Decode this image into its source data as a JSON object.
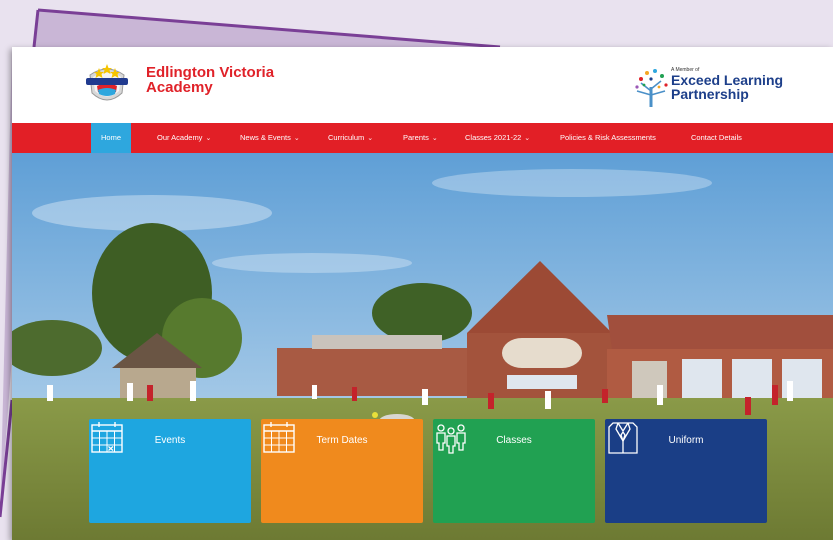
{
  "header": {
    "school_name_line1": "Edlington Victoria",
    "school_name_line2": "Academy",
    "crest_text": "Edlington Victoria Academy",
    "partner_small": "A Member of",
    "partner_line1": "Exceed Learning",
    "partner_line2": "Partnership"
  },
  "nav": {
    "items": [
      {
        "label": "Home",
        "dropdown": false,
        "active": true
      },
      {
        "label": "Our Academy",
        "dropdown": true
      },
      {
        "label": "News & Events",
        "dropdown": true
      },
      {
        "label": "Curriculum",
        "dropdown": true
      },
      {
        "label": "Parents",
        "dropdown": true
      },
      {
        "label": "Classes 2021-22",
        "dropdown": true
      },
      {
        "label": "Policies & Risk Assessments",
        "dropdown": false
      },
      {
        "label": "Contact Details",
        "dropdown": false
      }
    ],
    "caret": "⌄"
  },
  "tiles": [
    {
      "label": "Events",
      "color": "#1ea6e0",
      "icon": "calendar-icon"
    },
    {
      "label": "Term Dates",
      "color": "#f08a1d",
      "icon": "calendar-grid-icon"
    },
    {
      "label": "Classes",
      "color": "#21a152",
      "icon": "people-icon"
    },
    {
      "label": "Uniform",
      "color": "#1a3e86",
      "icon": "shirt-icon"
    }
  ],
  "colors": {
    "nav_red": "#e21f26",
    "active_blue": "#2ea7de",
    "school_red": "#e02229",
    "partner_blue": "#1d3f8a",
    "backdrop_purple": "#c9b6d6",
    "backdrop_border": "#7a3f96"
  }
}
